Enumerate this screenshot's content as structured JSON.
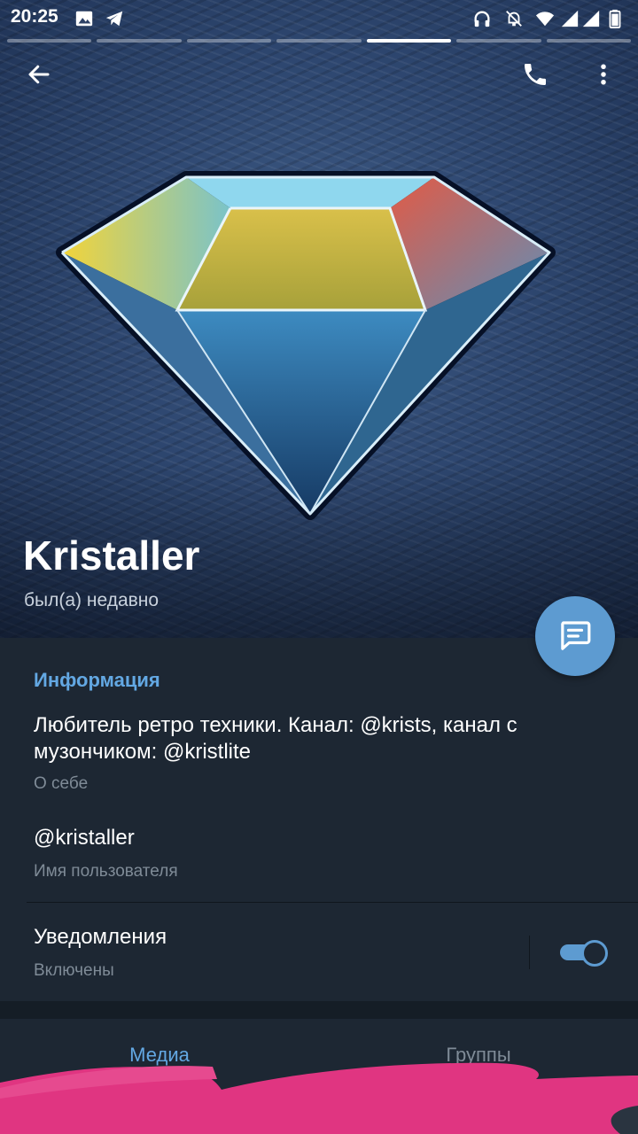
{
  "status_bar": {
    "time": "20:25",
    "icons_left": [
      "image-icon",
      "telegram-icon"
    ],
    "icons_right": [
      "headphones-icon",
      "notifications-off-icon",
      "wifi-icon",
      "signal-icon",
      "signal-icon-2",
      "battery-icon"
    ]
  },
  "story_progress": {
    "segments": 7,
    "active_index": 4
  },
  "profile": {
    "name": "Kristaller",
    "status": "был(а) недавно"
  },
  "info": {
    "section_title": "Информация",
    "bio": "Любитель ретро техники. Канал: @krists, канал с музончиком: @kristlite",
    "bio_label": "О себе",
    "username": "@kristaller",
    "username_label": "Имя пользователя",
    "notifications_title": "Уведомления",
    "notifications_status": "Включены",
    "notifications_enabled": true
  },
  "tabs": [
    {
      "label": "Медиа",
      "active": true
    },
    {
      "label": "Группы",
      "active": false
    }
  ],
  "colors": {
    "accent": "#63a8e3",
    "fab": "#5d9bd1",
    "background": "#1d2733",
    "redaction": "#e03581"
  }
}
